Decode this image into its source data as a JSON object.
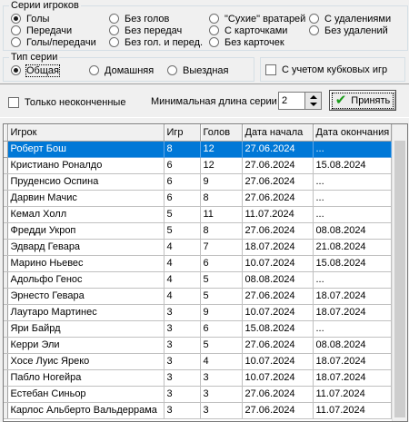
{
  "series_group": {
    "title": "Серии игроков",
    "options": [
      {
        "label": "Голы",
        "selected": true
      },
      {
        "label": "Передачи",
        "selected": false
      },
      {
        "label": "Голы/передачи",
        "selected": false
      },
      {
        "label": "Без голов",
        "selected": false
      },
      {
        "label": "Без передач",
        "selected": false
      },
      {
        "label": "Без гол. и перед.",
        "selected": false
      },
      {
        "label": "\"Сухие\" вратарей",
        "selected": false
      },
      {
        "label": "С карточками",
        "selected": false
      },
      {
        "label": "Без карточек",
        "selected": false
      },
      {
        "label": "С удалениями",
        "selected": false
      },
      {
        "label": "Без удалений",
        "selected": false
      }
    ]
  },
  "type_group": {
    "title": "Тип серии",
    "options": [
      {
        "label": "Общая",
        "selected": true
      },
      {
        "label": "Домашняя",
        "selected": false
      },
      {
        "label": "Выездная",
        "selected": false
      }
    ]
  },
  "cup_checkbox": {
    "label": "С учетом кубковых игр",
    "checked": false
  },
  "unfinished_checkbox": {
    "label": "Только неоконченные",
    "checked": false
  },
  "min_length": {
    "label": "Минимальная длина серии",
    "value": "2"
  },
  "apply_button": {
    "label": "Принять"
  },
  "table": {
    "columns": [
      "Игрок",
      "Игр",
      "Голов",
      "Дата начала",
      "Дата окончания"
    ],
    "rows": [
      [
        "Роберт Бош",
        "8",
        "12",
        "27.06.2024",
        "..."
      ],
      [
        "Кристиано Роналдо",
        "6",
        "12",
        "27.06.2024",
        "15.08.2024"
      ],
      [
        "Пруденсио Оспина",
        "6",
        "9",
        "27.06.2024",
        "..."
      ],
      [
        "Дарвин Мачис",
        "6",
        "8",
        "27.06.2024",
        "..."
      ],
      [
        "Кемал Холл",
        "5",
        "11",
        "11.07.2024",
        "..."
      ],
      [
        "Фредди Укроп",
        "5",
        "8",
        "27.06.2024",
        "08.08.2024"
      ],
      [
        "Эдвард Гевара",
        "4",
        "7",
        "18.07.2024",
        "21.08.2024"
      ],
      [
        "Марино Ньевес",
        "4",
        "6",
        "10.07.2024",
        "15.08.2024"
      ],
      [
        "Адольфо Генос",
        "4",
        "5",
        "08.08.2024",
        "..."
      ],
      [
        "Эрнесто Гевара",
        "4",
        "5",
        "27.06.2024",
        "18.07.2024"
      ],
      [
        "Лаутаро Мартинес",
        "3",
        "9",
        "10.07.2024",
        "18.07.2024"
      ],
      [
        "Яри Байрд",
        "3",
        "6",
        "15.08.2024",
        "..."
      ],
      [
        "Керри Эли",
        "3",
        "5",
        "27.06.2024",
        "08.08.2024"
      ],
      [
        "Хосе Луис Яреко",
        "3",
        "4",
        "10.07.2024",
        "18.07.2024"
      ],
      [
        "Пабло Ногейра",
        "3",
        "3",
        "10.07.2024",
        "18.07.2024"
      ],
      [
        "Естебан Синьор",
        "3",
        "3",
        "27.06.2024",
        "11.07.2024"
      ],
      [
        "Карлос Альберто Вальдеррама",
        "3",
        "3",
        "27.06.2024",
        "11.07.2024"
      ]
    ],
    "selected_row": 0
  }
}
